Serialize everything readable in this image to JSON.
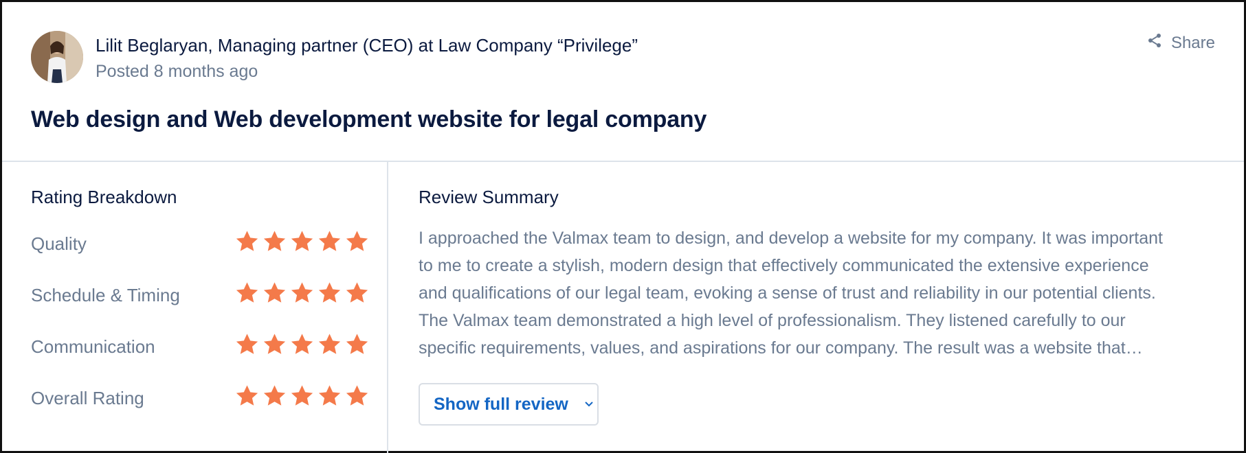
{
  "review": {
    "author": "Lilit Beglaryan, Managing partner (CEO) at Law Company “Privilege”",
    "posted": "Posted 8 months ago",
    "share_label": "Share",
    "title": "Web design and Web development website for legal company"
  },
  "rating_breakdown": {
    "heading": "Rating Breakdown",
    "rows": [
      {
        "label": "Quality",
        "stars": 5
      },
      {
        "label": "Schedule & Timing",
        "stars": 5
      },
      {
        "label": "Communication",
        "stars": 5
      },
      {
        "label": "Overall Rating",
        "stars": 5
      }
    ],
    "star_color": "#f47a4a"
  },
  "review_summary": {
    "heading": "Review Summary",
    "lines": [
      "I approached the Valmax team to design, and develop a website for my company. It was important",
      "to me to create a stylish, modern design that effectively communicated the extensive experience",
      "and qualifications of our legal team, evoking a sense of trust and reliability in our potential clients.",
      "The Valmax team demonstrated a high level of professionalism. They listened carefully to our",
      "specific requirements, values, and aspirations for our company. The result was a website that…"
    ],
    "button_label": "Show full review"
  },
  "colors": {
    "text_primary": "#0b1a3f",
    "text_muted": "#6a7a90",
    "link_blue": "#1466c4",
    "divider": "#dde3ea"
  }
}
